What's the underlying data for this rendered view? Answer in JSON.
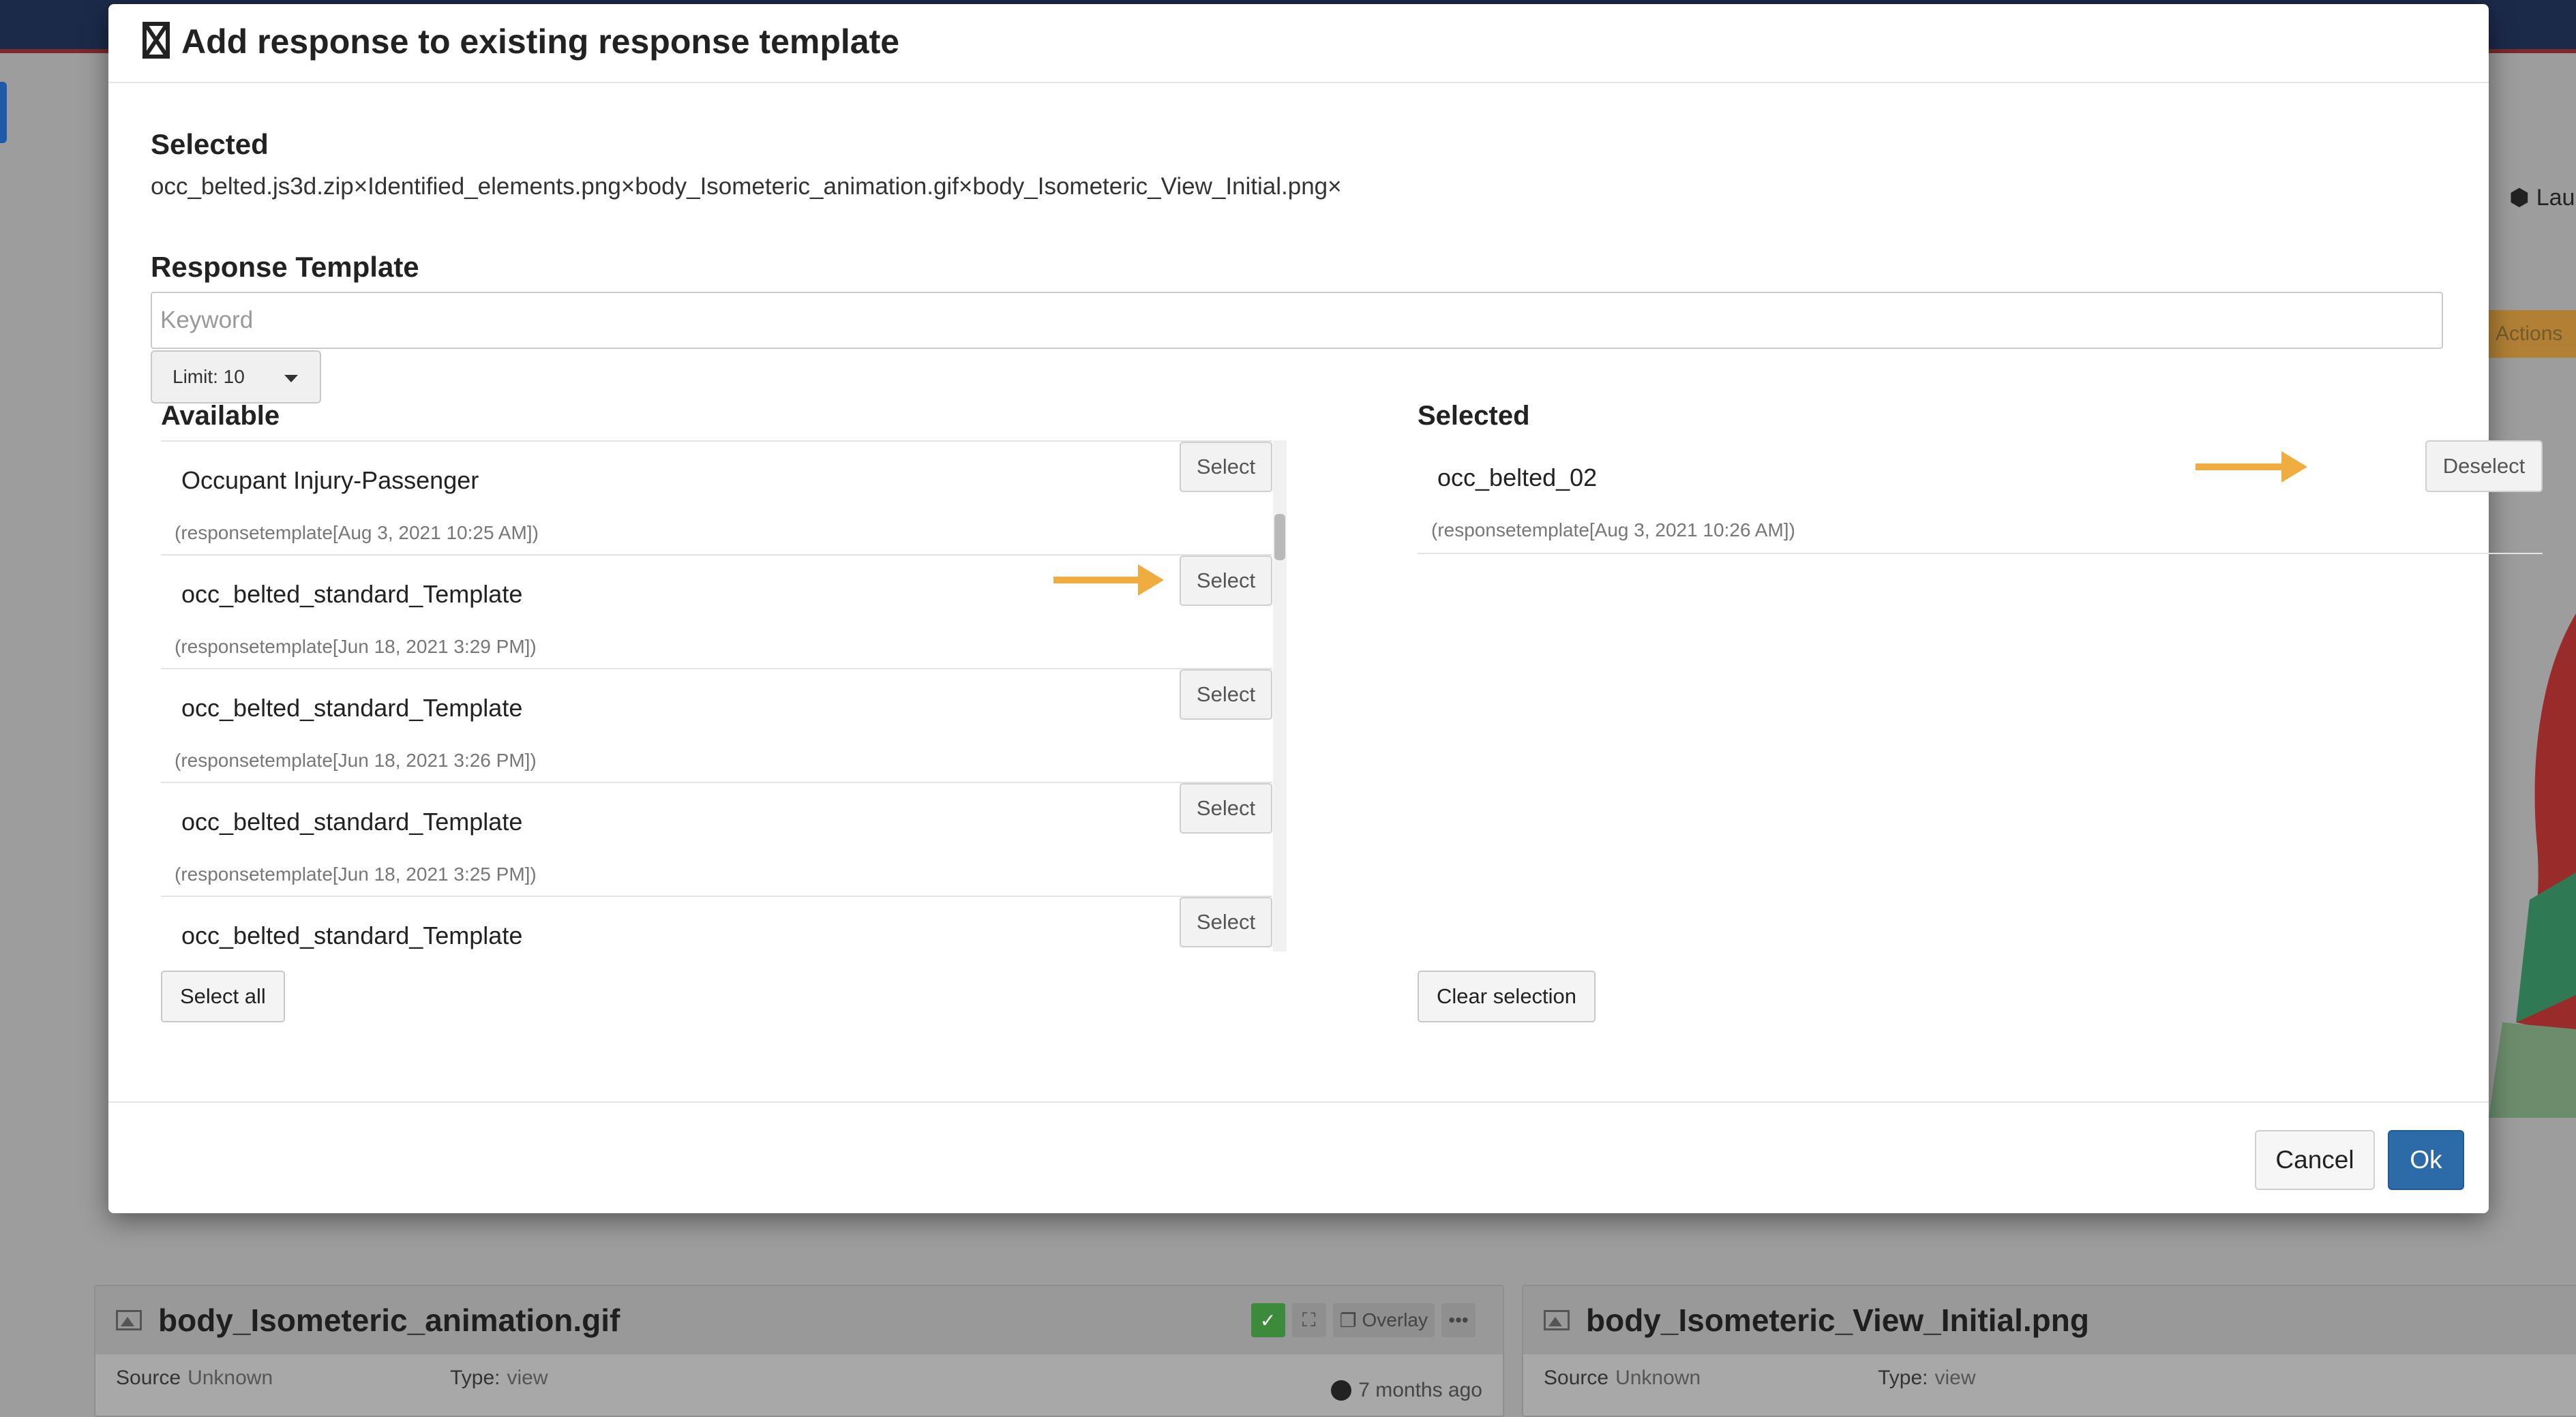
{
  "modal": {
    "title": "Add response to existing response template",
    "selected_files_label": "Selected",
    "selected_files": "occ_belted.js3d.zip×Identified_elements.png×body_Isometeric_animation.gif×body_Isometeric_View_Initial.png×",
    "response_template_label": "Response Template",
    "keyword_placeholder": "Keyword",
    "limit_label": "Limit: 10",
    "available_title": "Available",
    "selected_title": "Selected",
    "available_items": [
      {
        "name": "Occupant Injury-Passenger",
        "meta": "(responsetemplate[Aug 3, 2021 10:25 AM])",
        "button": "Select"
      },
      {
        "name": "occ_belted_standard_Template",
        "meta": "(responsetemplate[Jun 18, 2021 3:29 PM])",
        "button": "Select"
      },
      {
        "name": "occ_belted_standard_Template",
        "meta": "(responsetemplate[Jun 18, 2021 3:26 PM])",
        "button": "Select"
      },
      {
        "name": "occ_belted_standard_Template",
        "meta": "(responsetemplate[Jun 18, 2021 3:25 PM])",
        "button": "Select"
      },
      {
        "name": "occ_belted_standard_Template",
        "meta": "",
        "button": "Select"
      }
    ],
    "selected_items": [
      {
        "name": "occ_belted_02",
        "meta": "(responsetemplate[Aug 3, 2021 10:26 AM])",
        "button": "Deselect"
      }
    ],
    "select_all_label": "Select all",
    "clear_selection_label": "Clear selection",
    "cancel_label": "Cancel",
    "ok_label": "Ok"
  },
  "background": {
    "cards": [
      {
        "title": "body_Isometeric_animation.gif",
        "source_key": "Source",
        "source_val": "Unknown",
        "type_key": "Type:",
        "type_val": "view",
        "time": "7 months ago",
        "overlay_label": "Overlay"
      },
      {
        "title": "body_Isometeric_View_Initial.png",
        "source_key": "Source",
        "source_val": "Unknown",
        "type_key": "Type:",
        "type_val": "view"
      }
    ],
    "right_text": "Lau",
    "actions_label": "Actions"
  },
  "colors": {
    "primary": "#2d6ba8",
    "arrow": "#f0ad3f"
  }
}
